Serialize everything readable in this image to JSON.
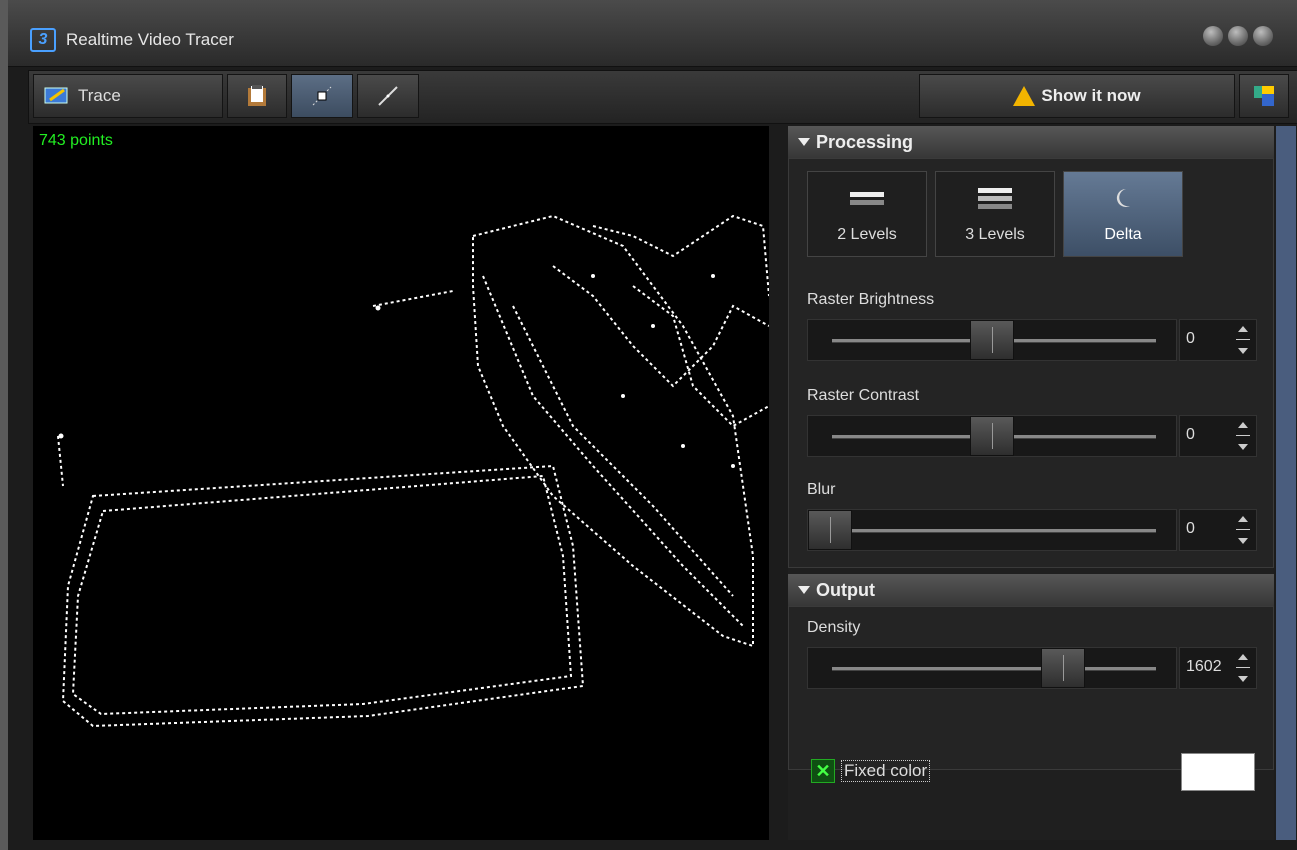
{
  "window": {
    "title": "Realtime Video Tracer"
  },
  "toolbar": {
    "trace_label": "Trace",
    "show_label": "Show it now"
  },
  "canvas": {
    "points_label": "743 points"
  },
  "processing": {
    "header": "Processing",
    "modes": [
      {
        "label": "2 Levels"
      },
      {
        "label": "3 Levels"
      },
      {
        "label": "Delta"
      }
    ],
    "sliders": [
      {
        "label": "Raster Brightness",
        "value": "0",
        "position": 0.5
      },
      {
        "label": "Raster Contrast",
        "value": "0",
        "position": 0.5
      },
      {
        "label": "Blur",
        "value": "0",
        "position": 0.0
      }
    ]
  },
  "output": {
    "header": "Output",
    "density": {
      "label": "Density",
      "value": "1602",
      "position": 0.72
    },
    "fixed_color_label": "Fixed color",
    "fixed_color_checked": true,
    "color": "#ffffff"
  }
}
